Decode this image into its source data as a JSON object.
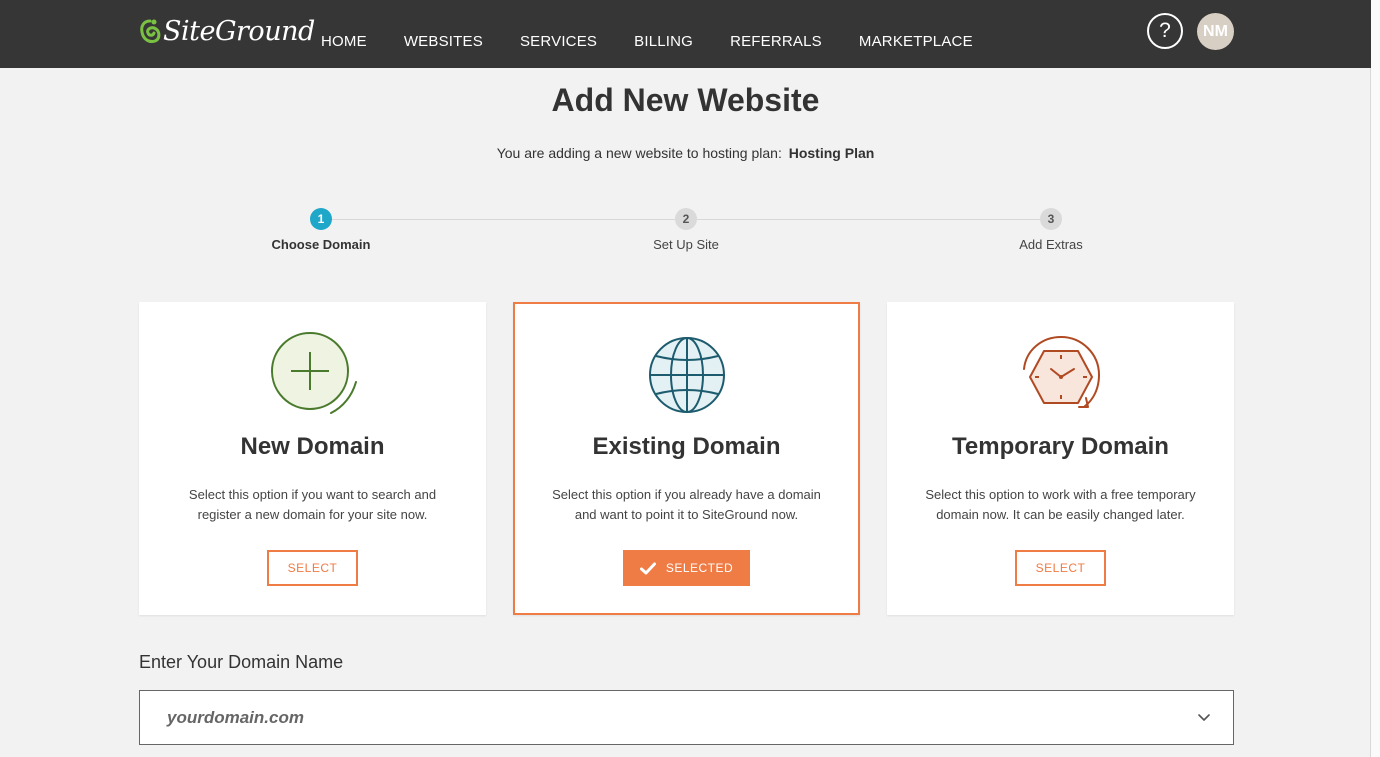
{
  "app": {
    "logo_text": "SiteGround",
    "accent_color": "#ef7b45",
    "header_bg": "#363636"
  },
  "nav": {
    "items": [
      {
        "label": "HOME"
      },
      {
        "label": "WEBSITES"
      },
      {
        "label": "SERVICES"
      },
      {
        "label": "BILLING"
      },
      {
        "label": "REFERRALS"
      },
      {
        "label": "MARKETPLACE"
      }
    ]
  },
  "header": {
    "help_icon": "question-icon",
    "help_symbol": "?",
    "avatar_initials": "NM"
  },
  "page": {
    "title": "Add New Website",
    "subtitle_prefix": "You are adding a new website to hosting plan:",
    "plan_name": "Hosting Plan"
  },
  "steps": [
    {
      "number": "1",
      "label": "Choose Domain",
      "active": true
    },
    {
      "number": "2",
      "label": "Set Up Site",
      "active": false
    },
    {
      "number": "3",
      "label": "Add Extras",
      "active": false
    }
  ],
  "options": [
    {
      "title": "New Domain",
      "description": "Select this option if you want to search and register a new domain for your site now.",
      "button": "SELECT",
      "selected": false,
      "icon": "plus-circle-icon"
    },
    {
      "title": "Existing Domain",
      "description": "Select this option if you already have a domain and want to point it to SiteGround now.",
      "button": "SELECTED",
      "selected": true,
      "icon": "globe-icon"
    },
    {
      "title": "Temporary Domain",
      "description": "Select this option to work with a free temporary domain now. It can be easily changed later.",
      "button": "SELECT",
      "selected": false,
      "icon": "clock-icon"
    }
  ],
  "domain_input": {
    "label": "Enter Your Domain Name",
    "placeholder": "yourdomain.com",
    "icon": "chevron-down-icon"
  }
}
